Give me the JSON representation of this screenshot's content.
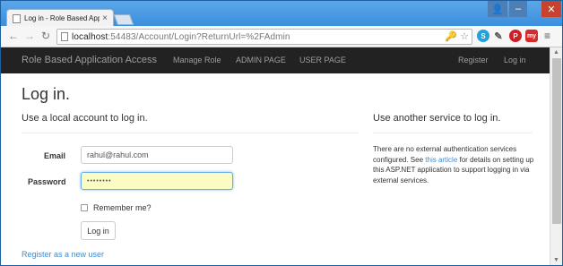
{
  "browser": {
    "tab_title": "Log in - Role Based Applic",
    "url_host": "localhost",
    "url_rest": ":54483/Account/Login?ReturnUrl=%2FAdmin",
    "extensions": {
      "skype": "S",
      "pinterest": "P",
      "my": "my"
    }
  },
  "navbar": {
    "brand": "Role Based Application Access",
    "links": [
      "Manage Role",
      "ADMIN PAGE",
      "USER PAGE"
    ],
    "register": "Register",
    "login": "Log in"
  },
  "page": {
    "title": "Log in.",
    "local_heading": "Use a local account to log in.",
    "service_heading": "Use another service to log in.",
    "email_label": "Email",
    "email_value": "rahul@rahul.com",
    "password_label": "Password",
    "password_value": "••••••••",
    "remember_label": "Remember me?",
    "login_button": "Log in",
    "register_link": "Register as a new user",
    "service_text_1": "There are no external authentication services configured. See ",
    "service_link": "this article",
    "service_text_2": " for details on setting up this ASP.NET application to support logging in via external services."
  }
}
